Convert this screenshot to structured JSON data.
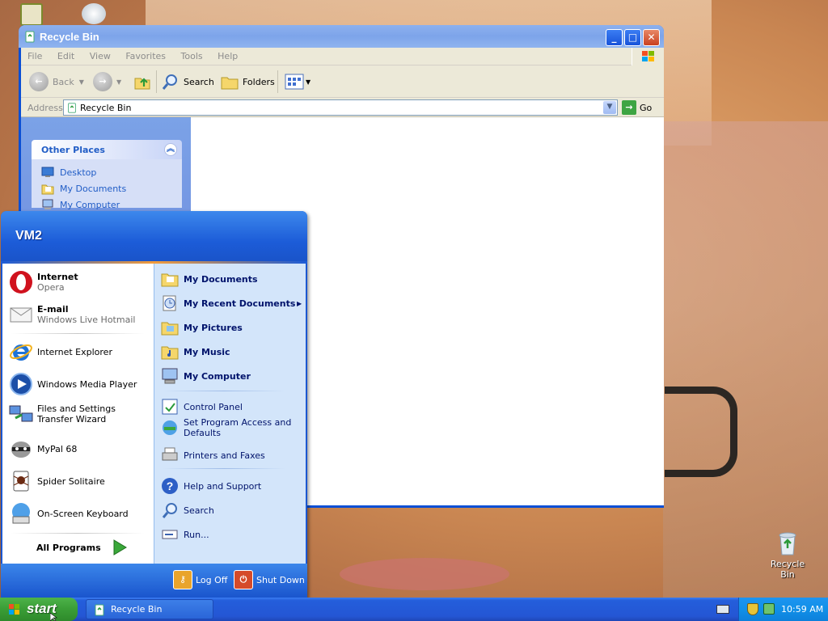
{
  "desktop": {
    "recycle_label": "Recycle Bin"
  },
  "explorer": {
    "title": "Recycle Bin",
    "menu": [
      "File",
      "Edit",
      "View",
      "Favorites",
      "Tools",
      "Help"
    ],
    "toolbar": {
      "back": "Back",
      "search": "Search",
      "folders": "Folders"
    },
    "address": {
      "label": "Address",
      "value": "Recycle Bin",
      "go": "Go"
    },
    "other_places": {
      "title": "Other Places",
      "items": [
        "Desktop",
        "My Documents",
        "My Computer"
      ]
    }
  },
  "start_menu": {
    "user": "VM2",
    "pinned": [
      {
        "title": "Internet",
        "sub": "Opera"
      },
      {
        "title": "E-mail",
        "sub": "Windows Live Hotmail"
      }
    ],
    "recent": [
      "Internet Explorer",
      "Windows Media Player",
      "Files and Settings Transfer Wizard",
      "MyPal 68",
      "Spider Solitaire",
      "On-Screen Keyboard"
    ],
    "all_programs": "All Programs",
    "right_bold": [
      "My Documents",
      "My Recent Documents",
      "My Pictures",
      "My Music",
      "My Computer"
    ],
    "right_mid": [
      "Control Panel",
      "Set Program Access and Defaults",
      "Printers and Faxes"
    ],
    "right_bottom": [
      "Help and Support",
      "Search",
      "Run..."
    ],
    "log_off": "Log Off",
    "shut_down": "Shut Down"
  },
  "taskbar": {
    "start": "start",
    "task": "Recycle Bin",
    "clock": "10:59 AM"
  }
}
